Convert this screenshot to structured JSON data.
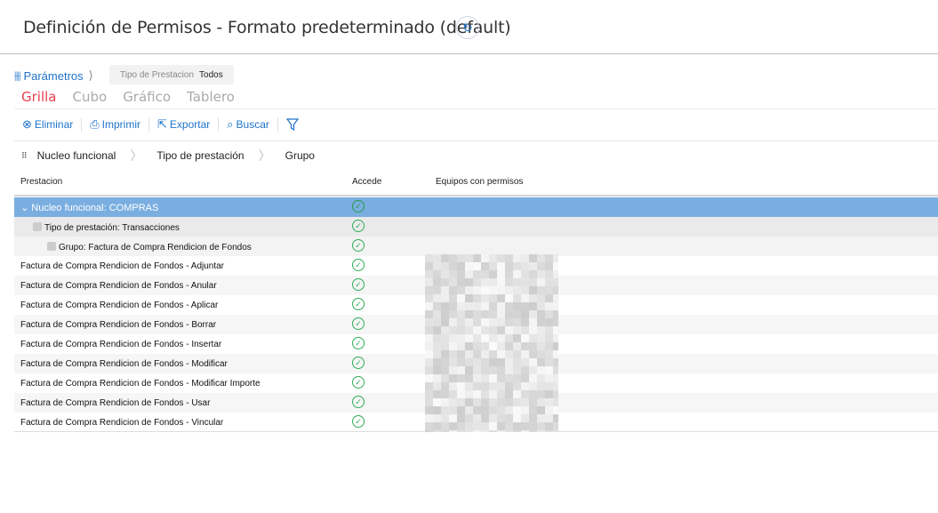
{
  "header": {
    "title": "Definición de Permisos - Formato predeterminado (default)"
  },
  "params": {
    "label": "Parámetros",
    "filter_key": "Tipo de Prestacion",
    "filter_value": "Todos"
  },
  "views": {
    "grid": "Grilla",
    "cube": "Cubo",
    "chart": "Gráfico",
    "board": "Tablero"
  },
  "toolbar": {
    "delete": "Eliminar",
    "print": "Imprimir",
    "export": "Exportar",
    "search": "Buscar"
  },
  "grouping": {
    "g1": "Nucleo funcional",
    "g2": "Tipo de prestación",
    "g3": "Grupo"
  },
  "columns": {
    "prestacion": "Prestacion",
    "accede": "Accede",
    "equipos": "Equipos con permisos"
  },
  "groups": {
    "g1": "Nucleo funcional: COMPRAS",
    "g2": "Tipo de prestación: Transacciones",
    "g3": "Grupo: Factura de Compra Rendicion de Fondos"
  },
  "rows": [
    "Factura de Compra Rendicion de Fondos - Adjuntar",
    "Factura de Compra Rendicion de Fondos - Anular",
    "Factura de Compra Rendicion de Fondos - Aplicar",
    "Factura de Compra Rendicion de Fondos - Borrar",
    "Factura de Compra Rendicion de Fondos - Insertar",
    "Factura de Compra Rendicion de Fondos - Modificar",
    "Factura de Compra Rendicion de Fondos - Modificar Importe",
    "Factura de Compra Rendicion de Fondos - Usar",
    "Factura de Compra Rendicion de Fondos - Vincular"
  ]
}
